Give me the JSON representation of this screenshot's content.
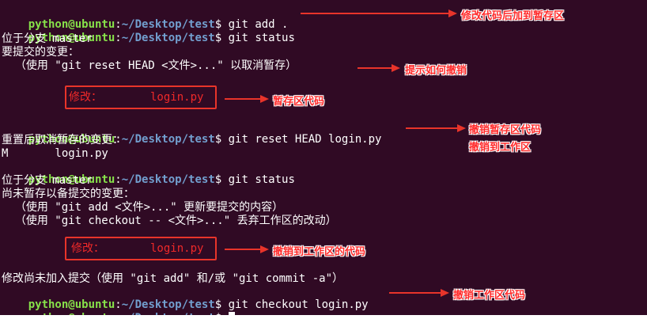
{
  "prompt": {
    "user_host": "python@ubuntu",
    "sep": ":",
    "path": "~/Desktop/test",
    "symbol": "$ "
  },
  "lines": [
    "git add .",
    "git status",
    "位于分支 master",
    "要提交的变更：",
    "  （使用 \"git reset HEAD <文件>...\" 以取消暂存）",
    "修改：",
    "login.py",
    "git reset HEAD login.py",
    "重置后取消暂存的变更：",
    "M       login.py",
    "git status",
    "位于分支 master",
    "尚未暂存以备提交的变更：",
    "  （使用 \"git add <文件>...\" 更新要提交的内容）",
    "  （使用 \"git checkout -- <文件>...\" 丢弃工作区的改动）",
    "修改：",
    "login.py",
    "修改尚未加入提交（使用 \"git add\" 和/或 \"git commit -a\"）",
    "git checkout login.py"
  ],
  "annotations": {
    "a1": "修改代码后加到暂存区",
    "a2": "提示如何撤销",
    "a3": "暂存区代码",
    "a4": "撤销暂存区代码",
    "a5": "撤销到工作区",
    "a6": "撤销到工作区的代码",
    "a7": "撤销工作区代码"
  },
  "colors": {
    "background": "#300a24",
    "prompt_user": "#87e24a",
    "prompt_path": "#729fcf",
    "modified": "#ef2929",
    "annotation": "#e8342a"
  }
}
